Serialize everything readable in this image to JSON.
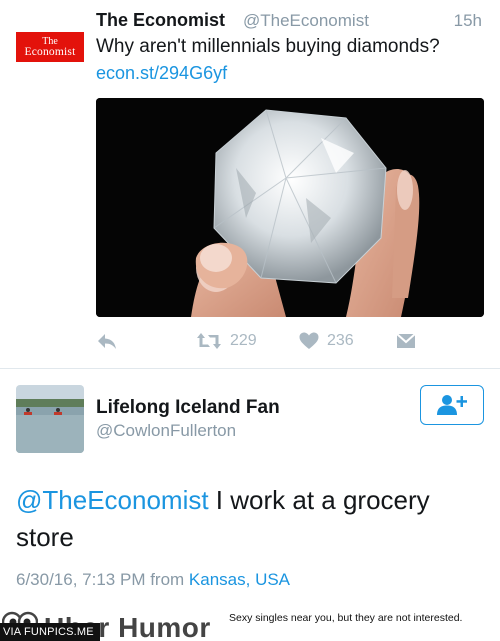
{
  "tweet1": {
    "logo_line1": "The",
    "logo_line2": "Economist",
    "name": "The Economist",
    "handle": "@TheEconomist",
    "time": "15h",
    "text": "Why aren't millennials buying diamonds?",
    "link": "econ.st/294G6yf",
    "retweets": "229",
    "likes": "236"
  },
  "tweet2": {
    "name": "Lifelong Iceland Fan",
    "handle": "@CowlonFullerton",
    "mention": "@TheEconomist",
    "body": " I work at a grocery store",
    "date": "6/30/16, 7:13 PM from ",
    "location": "Kansas, USA"
  },
  "watermark": {
    "brand": "Uber Humor",
    "tagline": "Sexy singles near you, but they are not interested.",
    "via": "VIA FUNPICS.ME"
  },
  "colors": {
    "link": "#1b95e0",
    "muted": "#8899a6",
    "action": "#aab8c2",
    "economist_red": "#e3120b"
  }
}
